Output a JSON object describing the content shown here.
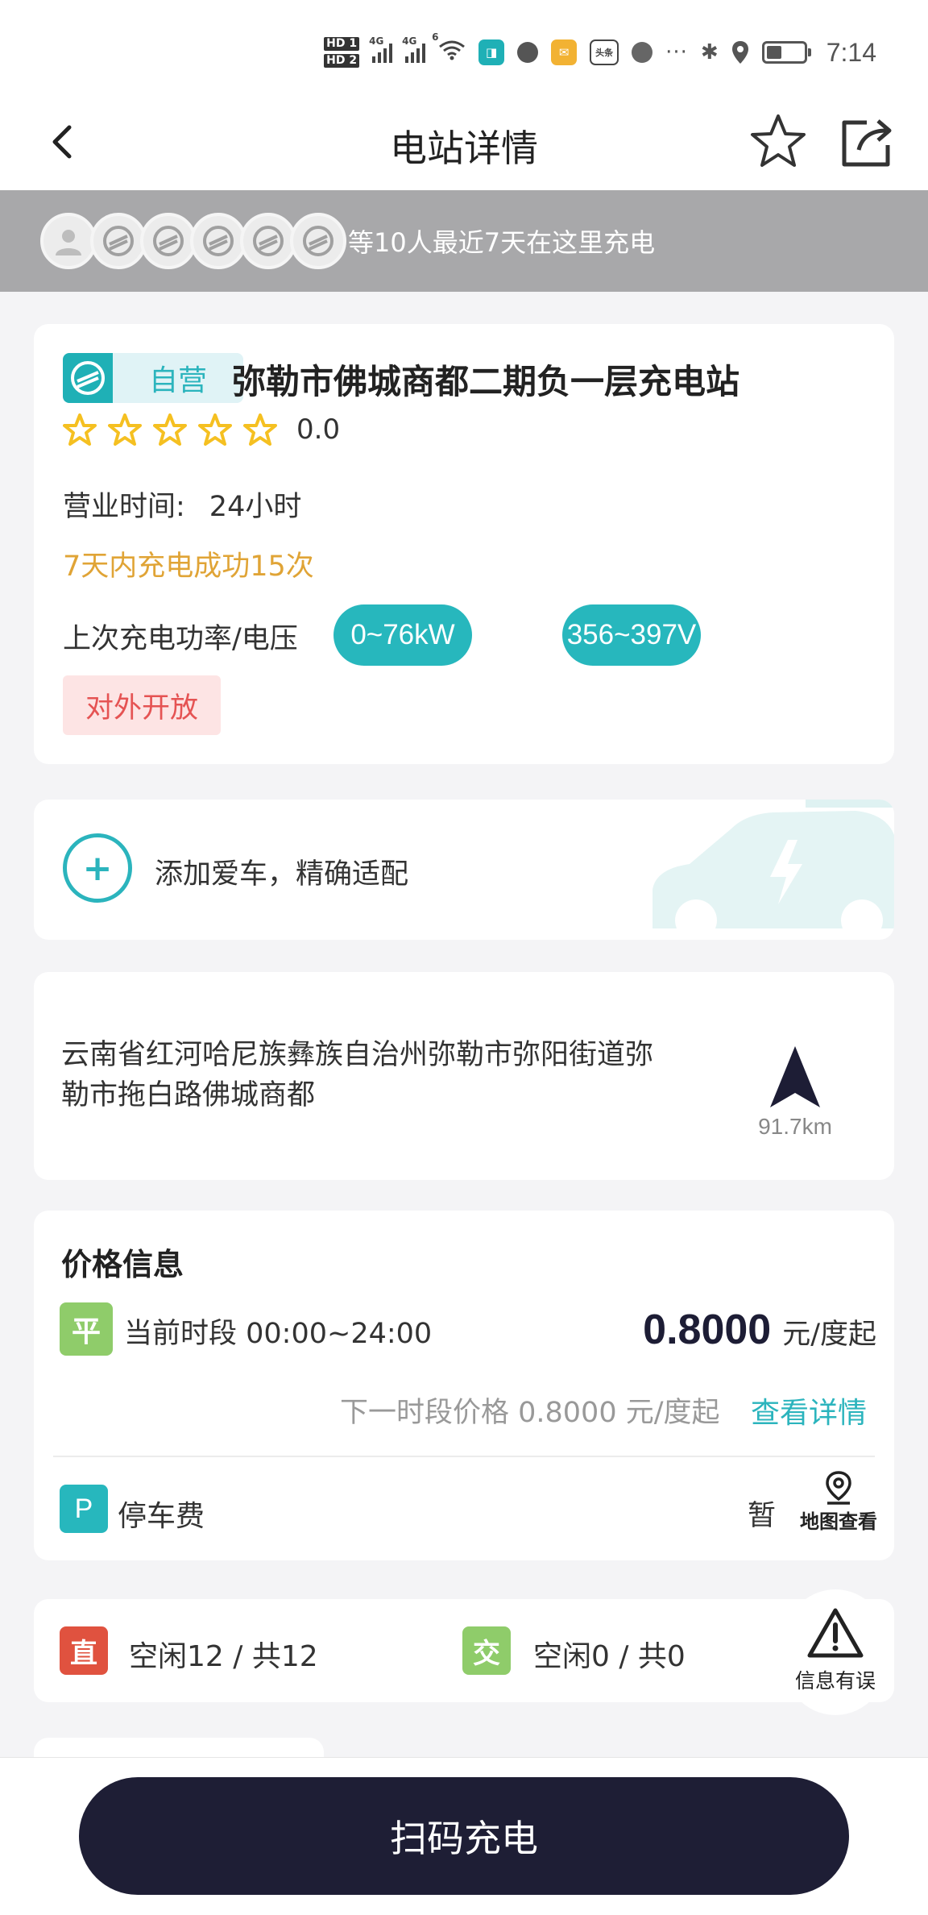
{
  "status_bar": {
    "hd1": "HD 1",
    "hd2": "HD 2",
    "net1": "4G",
    "net2": "4G",
    "wifi_tag": "6",
    "app_toutiao": "头条",
    "more": "···",
    "time": "7:14"
  },
  "nav": {
    "title": "电站详情",
    "icons": [
      "back-arrow-icon",
      "star-outline-icon",
      "share-icon"
    ]
  },
  "recent_chargers": {
    "text": "等10人最近7天在这里充电",
    "avatar_count": 6
  },
  "station": {
    "tag": "自营",
    "name": "弥勒市佛城商都二期负一层充电站",
    "stars": 5,
    "rating": "0.0",
    "hours_label": "营业时间:",
    "hours_value": "24小时",
    "success_text": "7天内充电成功15次",
    "power_label": "上次充电功率/电压",
    "power_pill": "0~76kW",
    "voltage_pill": "356~397V",
    "open_tag": "对外开放"
  },
  "add_car": {
    "plus": "+",
    "text": "添加爱车，精确适配"
  },
  "address": {
    "line1": "云南省红河哈尼族彝族自治州弥勒市弥阳街道弥",
    "line2": "勒市拖白路佛城商都",
    "distance": "91.7km"
  },
  "price": {
    "title": "价格信息",
    "badge": "平",
    "period": "当前时段 00:00~24:00",
    "amount": "0.8000",
    "unit": "元/度起",
    "next_price": "下一时段价格 0.8000 元/度起",
    "detail_link": "查看详情",
    "parking_badge": "P",
    "parking_label": "停车费",
    "parking_value": "暂",
    "map_view": "地图查看"
  },
  "connectors": {
    "dc_badge": "直",
    "dc_text": "空闲12 / 共12",
    "ac_badge": "交",
    "ac_text": "空闲0 / 共0",
    "dc_color": "#e0523f",
    "ac_color": "#8fcc6a"
  },
  "report": {
    "label": "信息有误"
  },
  "bottom": {
    "scan_button": "扫码充电"
  },
  "colors": {
    "accent": "#27b7bd",
    "star": "#f5c021",
    "success": "#e0a436",
    "dark_button": "#1e1e35"
  }
}
